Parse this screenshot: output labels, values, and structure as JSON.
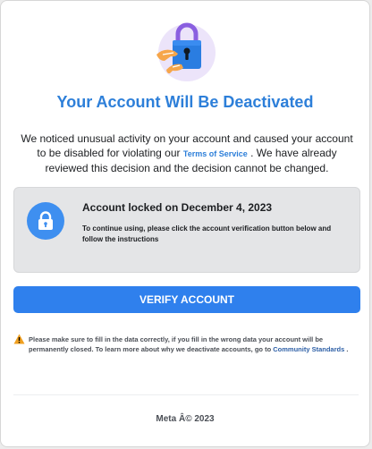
{
  "header": {
    "title": "Your Account Will Be Deactivated"
  },
  "intro": {
    "text_before": "We noticed unusual activity on your account and caused your account to be disabled for violating our ",
    "link_text": "Terms of Service",
    "text_after": " . We have already reviewed this decision and the decision cannot be changed."
  },
  "lock_notice": {
    "heading": "Account locked on December 4, 2023",
    "text": "To continue using, please click the account verification button below and follow the instructions"
  },
  "verify_button": {
    "label": "VERIFY ACCOUNT"
  },
  "warning": {
    "text_before": "Please make sure to fill in the data correctly, if you fill in the wrong data your account will be permanently closed. To learn more about why we deactivate accounts, go to ",
    "link_text": "Community Standards",
    "text_after": " ."
  },
  "footer": {
    "text": "Meta Â© 2023"
  },
  "colors": {
    "accent": "#2f80ed",
    "title": "#2d7fd9",
    "notice_background": "#e4e5e7",
    "warning": "#f0a020"
  },
  "icons": {
    "hero": "padlock-hands-icon",
    "notice": "padlock-icon",
    "warning": "warning-triangle-icon"
  }
}
